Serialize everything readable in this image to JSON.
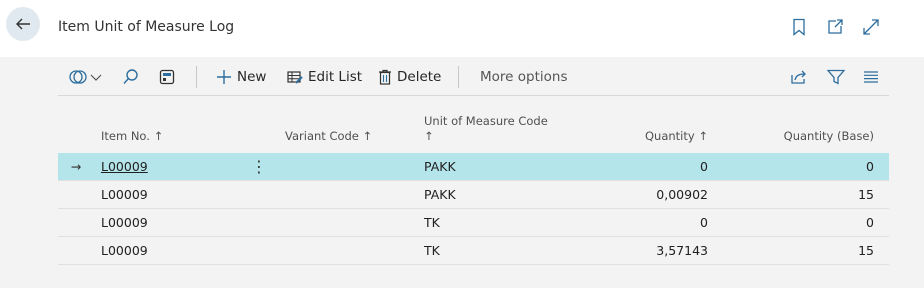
{
  "header": {
    "title": "Item Unit of Measure Log",
    "icons": [
      "bookmark-icon",
      "open-in-new-window-icon",
      "expand-icon"
    ]
  },
  "toolbar": {
    "new_label": "New",
    "edit_list_label": "Edit List",
    "delete_label": "Delete",
    "more_options_label": "More options"
  },
  "table": {
    "columns": [
      "Item No. ↑",
      "Variant Code ↑",
      "Unit of Measure Code",
      "↑",
      "Quantity ↑",
      "Quantity (Base)"
    ],
    "rows": [
      {
        "item_no": "L00009",
        "variant_code": "",
        "uom_code": "PAKK",
        "quantity": "0",
        "quantity_base": "0",
        "selected": true
      },
      {
        "item_no": "L00009",
        "variant_code": "",
        "uom_code": "PAKK",
        "quantity": "0,00902",
        "quantity_base": "15",
        "selected": false
      },
      {
        "item_no": "L00009",
        "variant_code": "",
        "uom_code": "TK",
        "quantity": "0",
        "quantity_base": "0",
        "selected": false
      },
      {
        "item_no": "L00009",
        "variant_code": "",
        "uom_code": "TK",
        "quantity": "3,57143",
        "quantity_base": "15",
        "selected": false
      }
    ]
  },
  "colors": {
    "selected_row": "#b4e5ea",
    "accent": "#2d6e9e"
  }
}
